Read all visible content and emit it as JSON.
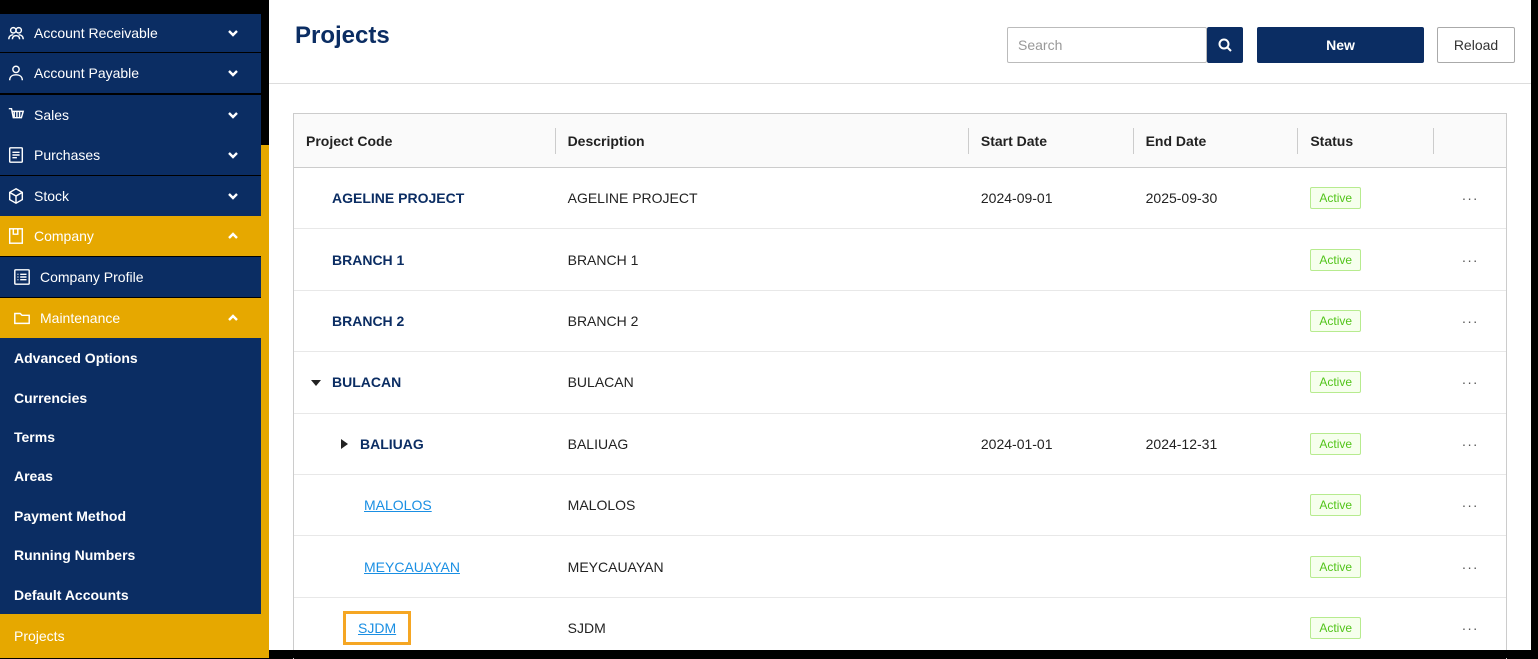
{
  "sidebar": {
    "items": [
      {
        "label": "Account Receivable",
        "icon": "customers-icon"
      },
      {
        "label": "Account Payable",
        "icon": "user-icon"
      },
      {
        "label": "Sales",
        "icon": "cart-icon"
      },
      {
        "label": "Purchases",
        "icon": "document-icon"
      },
      {
        "label": "Stock",
        "icon": "box-icon"
      },
      {
        "label": "Company",
        "icon": "building-icon"
      },
      {
        "label": "Company Profile",
        "icon": "list-icon"
      },
      {
        "label": "Maintenance",
        "icon": "folder-icon"
      }
    ],
    "leaves": [
      "Advanced Options",
      "Currencies",
      "Terms",
      "Areas",
      "Payment Method",
      "Running Numbers",
      "Default Accounts",
      "Projects"
    ]
  },
  "header": {
    "title": "Projects",
    "search_placeholder": "Search",
    "new_label": "New",
    "reload_label": "Reload"
  },
  "table": {
    "columns": [
      "Project Code",
      "Description",
      "Start Date",
      "End Date",
      "Status"
    ],
    "rows": [
      {
        "code": "AGELINE PROJECT",
        "description": "AGELINE PROJECT",
        "start": "2024-09-01",
        "end": "2025-09-30",
        "status": "Active",
        "more": "···"
      },
      {
        "code": "BRANCH 1",
        "description": "BRANCH 1",
        "start": "",
        "end": "",
        "status": "Active",
        "more": "···"
      },
      {
        "code": "BRANCH 2",
        "description": "BRANCH 2",
        "start": "",
        "end": "",
        "status": "Active",
        "more": "···"
      },
      {
        "code": "BULACAN",
        "description": "BULACAN",
        "start": "",
        "end": "",
        "status": "Active",
        "more": "···"
      },
      {
        "code": "BALIUAG",
        "description": "BALIUAG",
        "start": "2024-01-01",
        "end": "2024-12-31",
        "status": "Active",
        "more": "···"
      },
      {
        "code": "MALOLOS",
        "description": "MALOLOS",
        "start": "",
        "end": "",
        "status": "Active",
        "more": "···"
      },
      {
        "code": "MEYCAUAYAN",
        "description": "MEYCAUAYAN",
        "start": "",
        "end": "",
        "status": "Active",
        "more": "···"
      },
      {
        "code": "SJDM",
        "description": "SJDM",
        "start": "",
        "end": "",
        "status": "Active",
        "more": "···"
      }
    ]
  },
  "colors": {
    "navy": "#0b2d63",
    "gold": "#e6a800",
    "link": "#1a8fe3",
    "active_green": "#52c41a",
    "highlight": "#f5a623"
  }
}
